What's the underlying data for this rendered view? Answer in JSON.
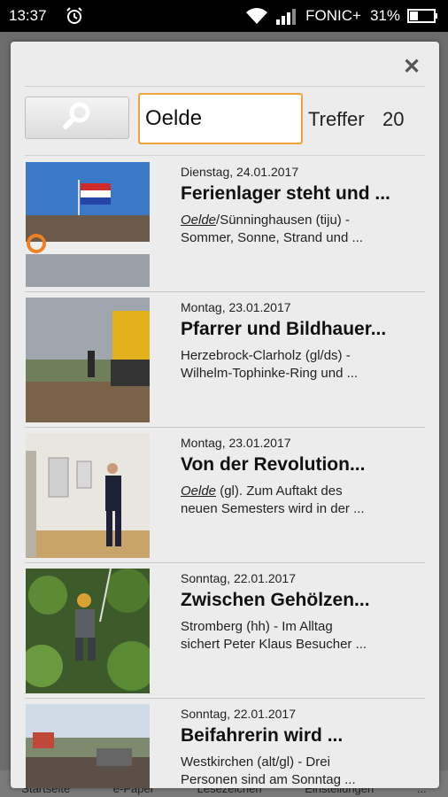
{
  "status": {
    "time": "13:37",
    "carrier": "FONIC+",
    "battery": "31%"
  },
  "background_nav": [
    "Startseite",
    "e-Paper",
    "Lesezeichen",
    "Einstellungen",
    "..."
  ],
  "dialog": {
    "close_icon": "close-icon",
    "search_icon": "search-icon",
    "search_value": "Oelde",
    "hits_label": "Treffer",
    "hits_count": "20"
  },
  "results": [
    {
      "date": "Dienstag, 24.01.2017",
      "title": "Ferienlager steht und ...",
      "highlight": "Oelde",
      "rest_line1": "/Sünninghausen (tiju) -",
      "rest_line2": " Sommer, Sonne, Strand und ..."
    },
    {
      "date": "Montag, 23.01.2017",
      "title": "Pfarrer und Bildhauer...",
      "highlight": "",
      "rest_line1": "Herzebrock-Clarholz (gl/ds) -",
      "rest_line2": " Wilhelm-Tophinke-Ring und ..."
    },
    {
      "date": "Montag, 23.01.2017",
      "title": "Von der Revolution...",
      "highlight": "Oelde",
      "rest_line1": " (gl). Zum Auftakt des",
      "rest_line2": "neuen Semesters wird in der ..."
    },
    {
      "date": "Sonntag, 22.01.2017",
      "title": "Zwischen Gehölzen...",
      "highlight": "",
      "rest_line1": "Stromberg (hh) - Im Alltag",
      "rest_line2": "sichert Peter Klaus Besucher ..."
    },
    {
      "date": "Sonntag, 22.01.2017",
      "title": "Beifahrerin wird ...",
      "highlight": "",
      "rest_line1": "Westkirchen (alt/gl) - Drei",
      "rest_line2": "Personen sind am Sonntag ..."
    }
  ]
}
